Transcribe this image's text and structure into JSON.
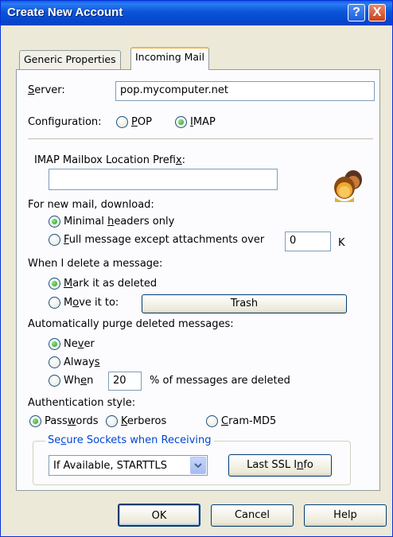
{
  "window": {
    "title": "Create New Account"
  },
  "titlebar": {
    "help_label": "?",
    "close_label": "X"
  },
  "tabs": [
    {
      "label": "Generic Properties"
    },
    {
      "label": "Incoming Mail"
    }
  ],
  "server": {
    "label_pre": "",
    "label_u": "S",
    "label_post": "erver:",
    "value": "pop.mycomputer.net"
  },
  "configuration": {
    "label": "Configuration:",
    "options": [
      {
        "u": "P",
        "rest": "OP",
        "checked": false
      },
      {
        "u": "I",
        "rest": "MAP",
        "checked": true
      }
    ]
  },
  "imap_prefix": {
    "label_pre": "IMAP Mailbox Location Prefi",
    "label_u": "x",
    "label_post": ":",
    "value": ""
  },
  "new_mail": {
    "label": "For new mail, download:",
    "opt1": {
      "pre": "Minimal ",
      "u": "h",
      "post": "eaders only",
      "checked": true
    },
    "opt2": {
      "pre": "",
      "u": "F",
      "post": "ull message except attachments over",
      "checked": false
    },
    "size_value": "0",
    "size_unit": "K"
  },
  "delete": {
    "label": "When I delete a message:",
    "opt1": {
      "pre": "",
      "u": "M",
      "post": "ark it as deleted",
      "checked": true
    },
    "opt2": {
      "pre": "M",
      "u": "o",
      "post": "ve it to:",
      "checked": false
    },
    "folder_button": "Trash"
  },
  "purge": {
    "label": "Automatically purge deleted messages:",
    "opt1": {
      "pre": "Ne",
      "u": "v",
      "post": "er",
      "checked": true
    },
    "opt2": {
      "pre": "Alway",
      "u": "s",
      "post": "",
      "checked": false
    },
    "opt3": {
      "pre": "Wh",
      "u": "e",
      "post": "n",
      "checked": false
    },
    "percent_value": "20",
    "percent_suffix": "% of messages are deleted"
  },
  "auth": {
    "label": "Authentication style:",
    "opt1": {
      "pre": "Pass",
      "u": "w",
      "post": "ords",
      "checked": true
    },
    "opt2": {
      "pre": "",
      "u": "K",
      "post": "erberos",
      "checked": false
    },
    "opt3": {
      "pre": "",
      "u": "C",
      "post": "ram-MD5",
      "checked": false
    }
  },
  "ssl": {
    "legend_pre": "Se",
    "legend_u": "c",
    "legend_post": "ure Sockets when Receiving",
    "selected": "If Available, STARTTLS",
    "info_pre": "Last SSL I",
    "info_u": "n",
    "info_post": "fo"
  },
  "footer": {
    "ok": "OK",
    "cancel": "Cancel",
    "help": "Help"
  },
  "colors": {
    "title_bar": "#0a54d8",
    "dialog_bg": "#ece9d8",
    "legend_text": "#0046d5",
    "tab_highlight": "#f6b440"
  }
}
